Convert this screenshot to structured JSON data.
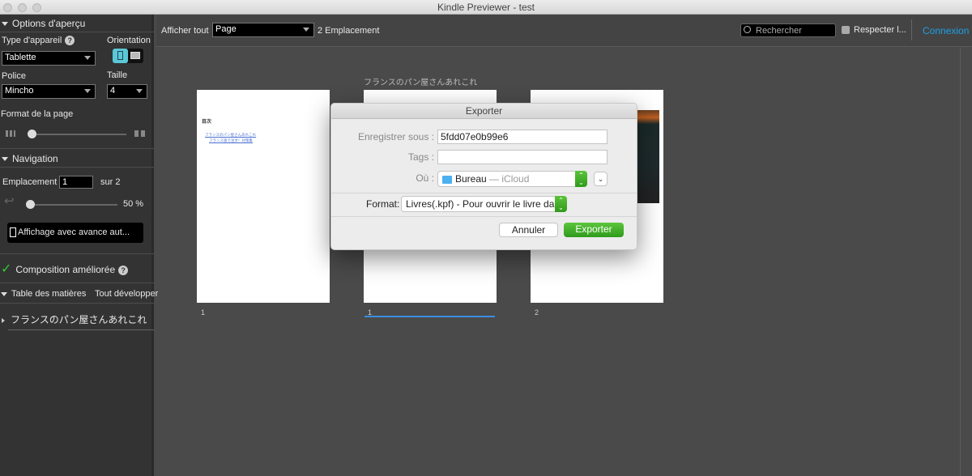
{
  "window": {
    "title": "Kindle Previewer - test"
  },
  "sidebar": {
    "preview_options": "Options d'aperçu",
    "device_type_label": "Type d'appareil",
    "device_type_value": "Tablette",
    "orientation_label": "Orientation",
    "font_label": "Police",
    "font_value": "Mincho",
    "size_label": "Taille",
    "size_value": "4",
    "page_format_label": "Format de la page",
    "page_format_level": 0,
    "navigation": "Navigation",
    "location_label": "Emplacement",
    "location_value": "1",
    "location_total": "sur 2",
    "progress_text": "50 %",
    "progress_value": 0,
    "autoplay_button": "Affichage avec avance aut...",
    "enhanced_typesetting": "Composition améliorée",
    "toc_label": "Table des matières",
    "expand_all": "Tout développer",
    "toc_items": [
      "フランスのパン屋さんあれこれ"
    ]
  },
  "toolbar": {
    "show_all_label": "Afficher tout",
    "view_mode": "Page",
    "locations": "2 Emplacement",
    "search_placeholder": "Rechercher",
    "respect_label": "Respecter l...",
    "login": "Connexion",
    "accent": "#1ea0e6"
  },
  "main": {
    "book_title": "フランスのパン屋さんあれこれ",
    "pages": [
      {
        "label": "1",
        "toc_heading": "目次",
        "toc_links": [
          "フランスのパン屋さんあれこれ",
          "フランス語で注文！対策集"
        ]
      },
      {
        "label": "1"
      },
      {
        "label": "2"
      }
    ]
  },
  "dialog": {
    "title": "Exporter",
    "save_as_label": "Enregistrer sous :",
    "save_as_value": "5fdd07e0b99e6",
    "tags_label": "Tags :",
    "tags_value": "",
    "where_label": "Où :",
    "where_value": "Bureau",
    "where_suffix": "— iCloud",
    "format_label": "Format:",
    "format_value": "Livres(.kpf) - Pour ouvrir le livre da...",
    "cancel": "Annuler",
    "export": "Exporter"
  }
}
